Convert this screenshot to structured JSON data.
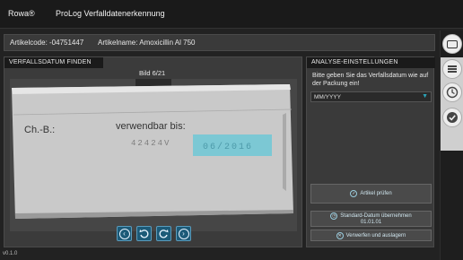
{
  "titlebar": {
    "brand": "Rowa®",
    "product": "ProLog Verfalldatenerkennung"
  },
  "infobar": {
    "article_code": "Artikelcode: -04751447",
    "article_name": "Artikelname: Amoxicillin Al 750"
  },
  "left_panel": {
    "title": "VERFALLSDATUM FINDEN",
    "image_counter": "Bild 6/21",
    "package_text": {
      "batch": "Ch.-B.:",
      "usable_until": "verwendbar bis:",
      "code_digits": "42424V",
      "date_digits": "06/2016"
    }
  },
  "right_panel": {
    "title": "ANALYSE-EINSTELLUNGEN",
    "instruction": "Bitte geben Sie das Verfallsdatum wie auf der Packung ein!",
    "date_input": {
      "value": "MM/YYYY"
    },
    "buttons": {
      "check": "Artikel prüfen",
      "standard_line1": "Standard-Datum übernehmen",
      "standard_line2": "01.01.01",
      "discard": "Verwerfen und auslagern"
    }
  },
  "nav_icons": [
    "prev-icon",
    "undo-icon",
    "redo-icon",
    "next-icon"
  ],
  "rail_icons": [
    "menu-icon",
    "stack-icon",
    "clock-icon",
    "checkmark-icon"
  ],
  "footer": {
    "version": "v0.1.0"
  },
  "colors": {
    "accent": "#2aa4b8",
    "highlight": "#6fc8d6",
    "nav_button": "#1c5a78"
  }
}
